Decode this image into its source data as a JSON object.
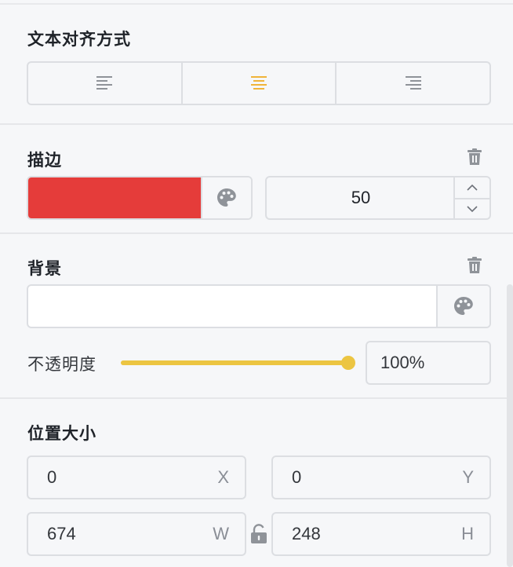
{
  "text_align": {
    "title": "文本对齐方式",
    "options": [
      "align-left",
      "align-center",
      "align-right"
    ],
    "selected": "align-center",
    "active_color": "#f0b43a",
    "inactive_color": "#8f9399"
  },
  "stroke": {
    "title": "描边",
    "color": "#e53c3a",
    "width_value": "50",
    "delete_icon": "trash-icon",
    "palette_icon": "palette-icon"
  },
  "background": {
    "title": "背景",
    "color": "#ffffff",
    "delete_icon": "trash-icon",
    "palette_icon": "palette-icon",
    "opacity_label": "不透明度",
    "opacity_value": "100%",
    "opacity_fraction": 1.0,
    "slider_color": "#ecc542"
  },
  "position_size": {
    "title": "位置大小",
    "x": {
      "value": "0",
      "suffix": "X"
    },
    "y": {
      "value": "0",
      "suffix": "Y"
    },
    "w": {
      "value": "674",
      "suffix": "W"
    },
    "h": {
      "value": "248",
      "suffix": "H"
    },
    "lock_icon": "unlock-icon"
  }
}
